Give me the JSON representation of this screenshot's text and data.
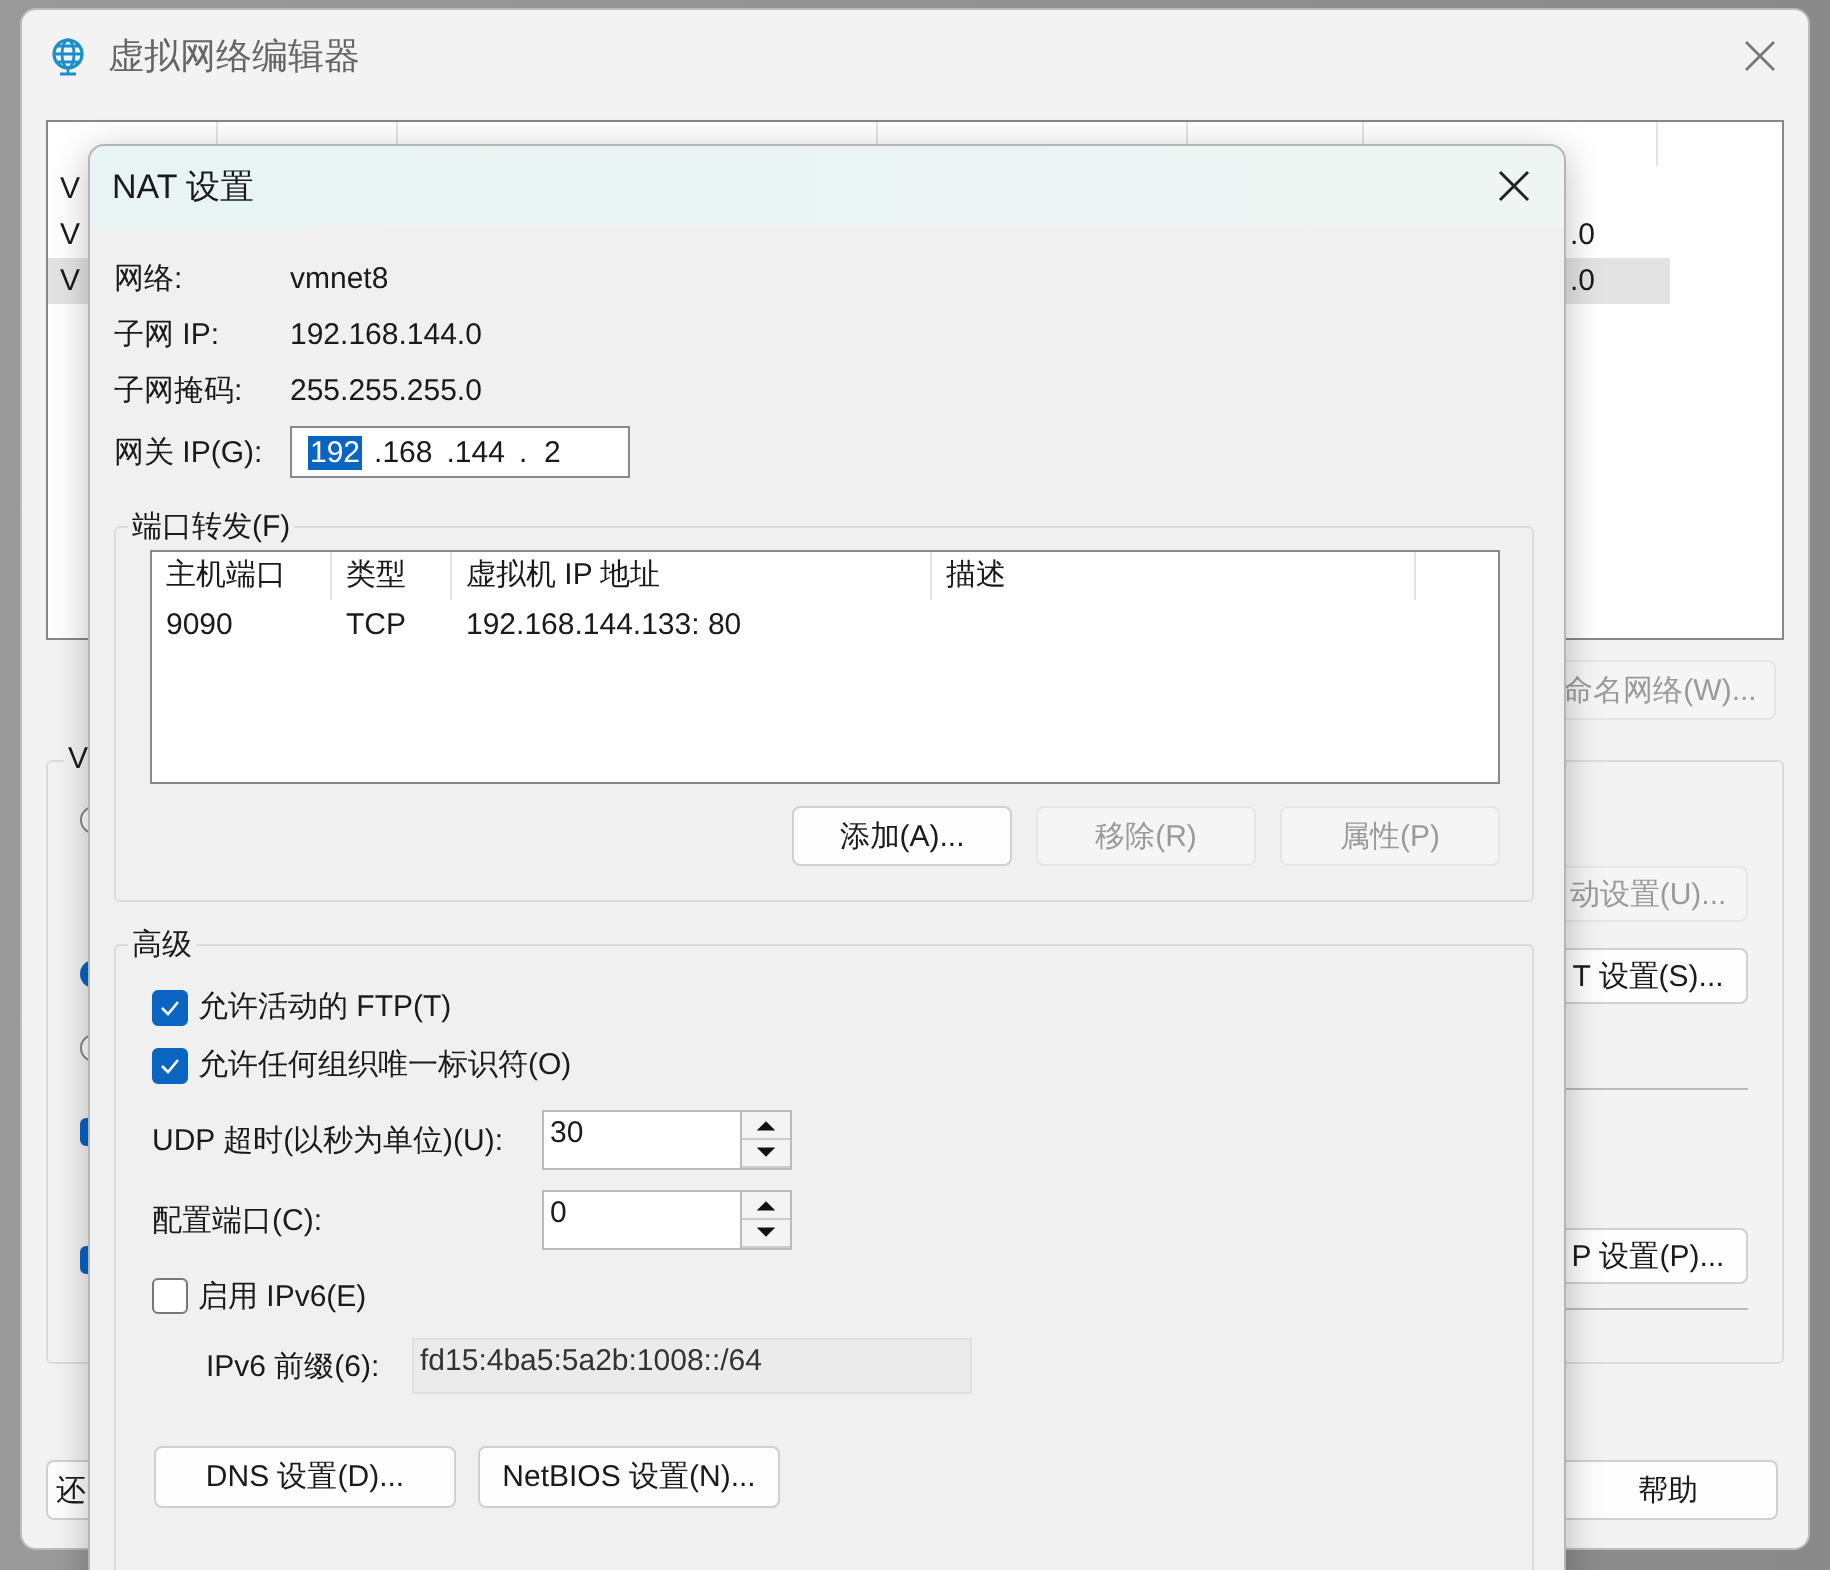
{
  "editor": {
    "title": "虚拟网络编辑器",
    "rows": [
      {
        "name": "V",
        "selected": false
      },
      {
        "name": "V",
        "subnet": ".0",
        "selected": false
      },
      {
        "name": "V",
        "subnet": ".0",
        "selected": true
      }
    ],
    "rename_button": {
      "label": "命名网络(W)...",
      "disabled": true
    },
    "group_label": "V",
    "options": [
      {
        "kind": "radio",
        "selected": false
      },
      {
        "kind": "radio",
        "selected": true
      },
      {
        "kind": "radio",
        "selected": false
      },
      {
        "kind": "checkbox",
        "checked": true
      },
      {
        "kind": "checkbox",
        "checked": true
      }
    ],
    "side_buttons": [
      {
        "label": "动设置(U)...",
        "disabled": true
      },
      {
        "label": "T 设置(S)...",
        "disabled": false
      },
      {
        "label": "P 设置(P)...",
        "disabled": false
      }
    ],
    "restore_button": "还",
    "help_button": "帮助"
  },
  "dialog": {
    "title": "NAT 设置",
    "info": [
      {
        "label": "网络:",
        "value": "vmnet8"
      },
      {
        "label": "子网 IP:",
        "value": "192.168.144.0"
      },
      {
        "label": "子网掩码:",
        "value": "255.255.255.0"
      }
    ],
    "gateway": {
      "label": "网关 IP(G):",
      "segments": [
        {
          "text": "192",
          "selected": true
        },
        {
          "text": ".168",
          "selected": false
        },
        {
          "text": ".144",
          "selected": false
        },
        {
          "text": ".  2",
          "selected": false
        }
      ]
    },
    "port_forwarding": {
      "title": "端口转发(F)",
      "columns": [
        "主机端口",
        "类型",
        "虚拟机 IP 地址",
        "描述"
      ],
      "rows": [
        {
          "cells": [
            "9090",
            "TCP",
            "192.168.144.133: 80",
            ""
          ]
        }
      ],
      "buttons": [
        {
          "label": "添加(A)...",
          "disabled": false
        },
        {
          "label": "移除(R)",
          "disabled": true
        },
        {
          "label": "属性(P)",
          "disabled": true
        }
      ]
    },
    "advanced": {
      "title": "高级",
      "checks": [
        {
          "label": "允许活动的 FTP(T)",
          "checked": true
        },
        {
          "label": "允许任何组织唯一标识符(O)",
          "checked": true
        }
      ],
      "spinners": [
        {
          "label": "UDP 超时(以秒为单位)(U):",
          "value": "30"
        },
        {
          "label": "配置端口(C):",
          "value": "0"
        }
      ],
      "ipv6": {
        "label": "启用 IPv6(E)",
        "checked": false
      },
      "prefix": {
        "label": "IPv6 前缀(6):",
        "value": "fd15:4ba5:5a2b:1008::/64",
        "disabled": true
      },
      "buttons": [
        "DNS 设置(D)...",
        "NetBIOS 设置(N)..."
      ]
    }
  }
}
